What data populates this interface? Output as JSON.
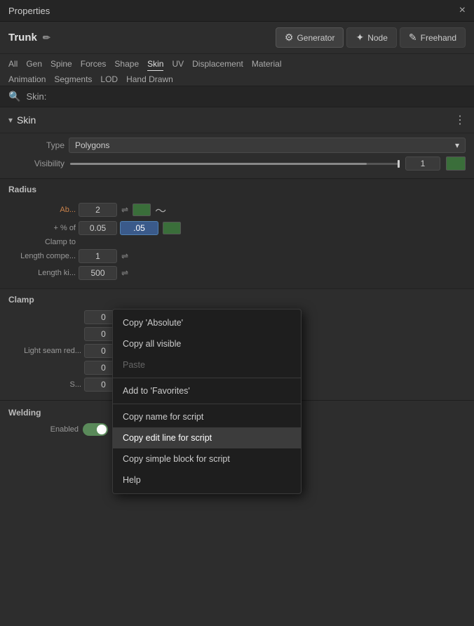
{
  "title_bar": {
    "title": "Properties",
    "close_label": "×"
  },
  "header": {
    "trunk_label": "Trunk",
    "edit_icon": "✏",
    "mode_buttons": [
      {
        "id": "generator",
        "icon": "⚙",
        "label": "Generator",
        "active": true
      },
      {
        "id": "node",
        "icon": "✦",
        "label": "Node",
        "active": false
      },
      {
        "id": "freehand",
        "icon": "✎",
        "label": "Freehand",
        "active": false
      }
    ]
  },
  "tabs": {
    "line1": [
      {
        "id": "all",
        "label": "All"
      },
      {
        "id": "gen",
        "label": "Gen"
      },
      {
        "id": "spine",
        "label": "Spine"
      },
      {
        "id": "forces",
        "label": "Forces"
      },
      {
        "id": "shape",
        "label": "Shape"
      },
      {
        "id": "skin",
        "label": "Skin",
        "active": true
      },
      {
        "id": "uv",
        "label": "UV"
      },
      {
        "id": "displacement",
        "label": "Displacement"
      },
      {
        "id": "material",
        "label": "Material"
      }
    ],
    "line2": [
      {
        "id": "animation",
        "label": "Animation"
      },
      {
        "id": "segments",
        "label": "Segments"
      },
      {
        "id": "lod",
        "label": "LOD"
      },
      {
        "id": "handdrawn",
        "label": "Hand Drawn"
      }
    ]
  },
  "search": {
    "icon": "🔍",
    "label": "Skin:"
  },
  "skin_section": {
    "title": "Skin",
    "chevron": "▾",
    "menu_icon": "⋮",
    "type_label": "Type",
    "type_value": "Polygons",
    "visibility_label": "Visibility",
    "visibility_value": "1"
  },
  "radius_section": {
    "label": "Radius",
    "rows": [
      {
        "id": "absolute",
        "label": "Ab...",
        "orange": true,
        "value": "2",
        "icon": "⇌",
        "swatch": "green",
        "curve": "~"
      },
      {
        "id": "percent",
        "label": "+ % of",
        "orange": false,
        "value": "0.05",
        "value2": ".05",
        "highlight2": true,
        "swatch": "green"
      },
      {
        "id": "clamp_to",
        "label": "Clamp to",
        "orange": false,
        "value": null,
        "swatch": null
      },
      {
        "id": "length_comp",
        "label": "Length compe...",
        "orange": false,
        "value": "1",
        "icon": "⇌"
      },
      {
        "id": "length_k",
        "label": "Length ki...",
        "orange": false,
        "value": "500",
        "icon": "⇌"
      }
    ]
  },
  "clamp_section": {
    "label": "Clamp",
    "rows": [
      {
        "id": "clamp1",
        "value": "0",
        "icon": "⇌",
        "swatch": "green"
      },
      {
        "id": "clamp2",
        "value": "0",
        "icon": "⇌",
        "swatch": "green"
      },
      {
        "id": "lightseam",
        "label": "Light seam red...",
        "value": "0",
        "icon": "⇌",
        "swatch": "blue"
      },
      {
        "id": "clamp4",
        "value": "0",
        "icon": "⇌",
        "swatch": "green"
      },
      {
        "id": "s_row",
        "label": "S...",
        "value": "0",
        "icon": "⇌",
        "swatch": "green"
      }
    ]
  },
  "context_menu": {
    "items": [
      {
        "id": "copy-absolute",
        "label": "Copy 'Absolute'",
        "active": false,
        "disabled": false
      },
      {
        "id": "copy-all-visible",
        "label": "Copy all visible",
        "active": false,
        "disabled": false
      },
      {
        "id": "paste",
        "label": "Paste",
        "active": false,
        "disabled": true
      },
      {
        "id": "divider1",
        "type": "divider"
      },
      {
        "id": "add-favorites",
        "label": "Add to 'Favorites'",
        "active": false,
        "disabled": false
      },
      {
        "id": "divider2",
        "type": "divider"
      },
      {
        "id": "copy-name",
        "label": "Copy name for script",
        "active": false,
        "disabled": false
      },
      {
        "id": "copy-edit-line",
        "label": "Copy edit line for script",
        "active": true,
        "disabled": false
      },
      {
        "id": "copy-simple-block",
        "label": "Copy simple block for script",
        "active": false,
        "disabled": false
      },
      {
        "id": "help",
        "label": "Help",
        "active": false,
        "disabled": false
      }
    ]
  },
  "welding_section": {
    "label": "Welding",
    "enabled_label": "Enabled"
  }
}
